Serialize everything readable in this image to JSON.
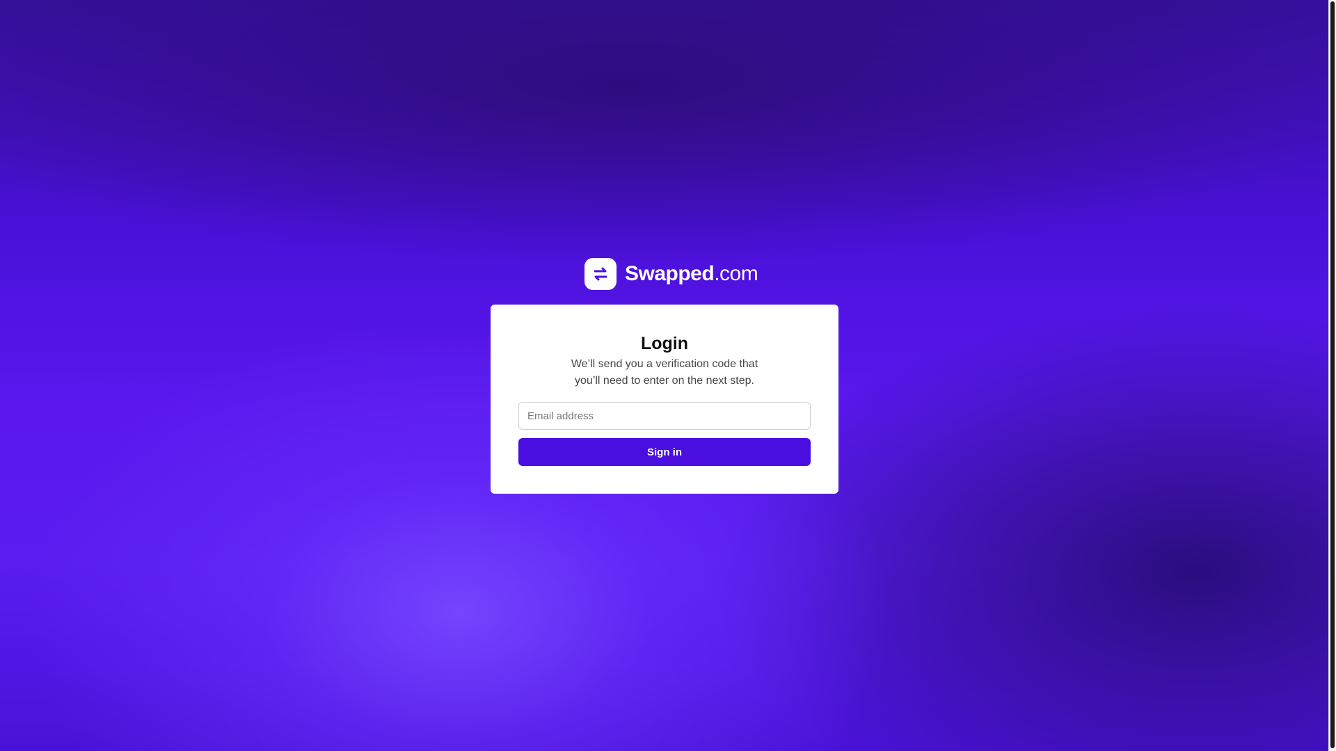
{
  "brand": {
    "name_bold": "Swapped",
    "name_light": ".com",
    "logo_icon": "swap-arrows-icon",
    "color": "#4a0fe0"
  },
  "login": {
    "title": "Login",
    "description": "We’ll send you a verification code that you’ll need to enter on the next step.",
    "email_placeholder": "Email address",
    "email_value": "",
    "submit_label": "Sign in"
  }
}
